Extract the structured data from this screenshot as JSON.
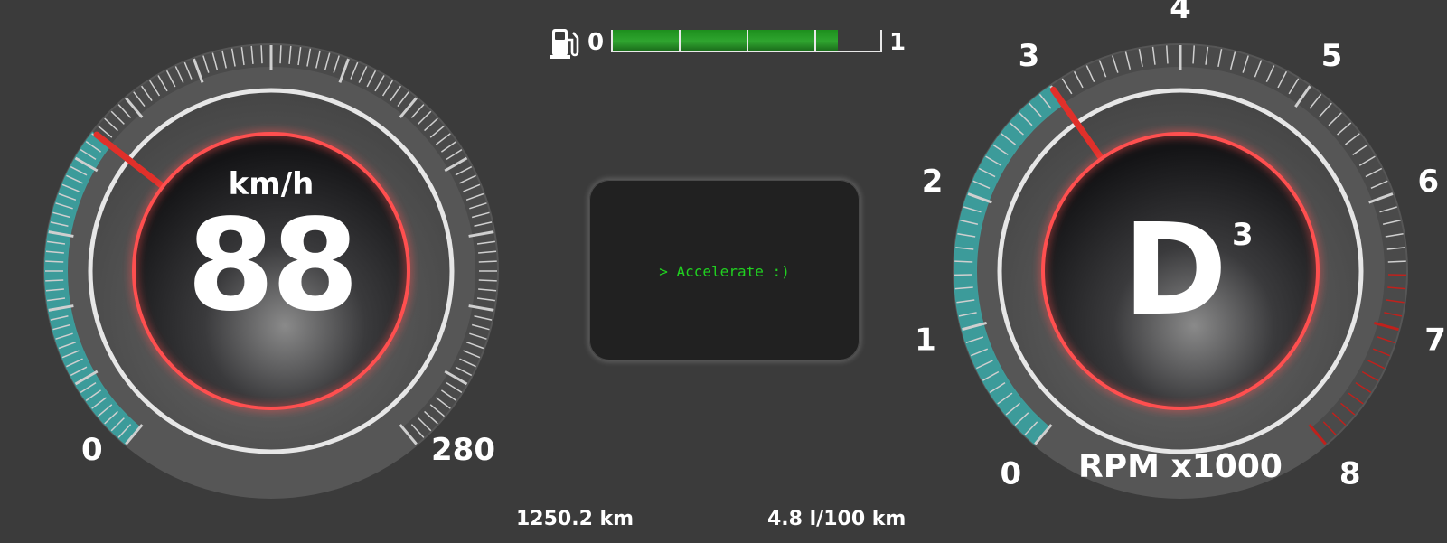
{
  "speedometer": {
    "unit": "km/h",
    "speed": "88",
    "min_label": "0",
    "max_label": "280",
    "needle_fraction": 0.3143
  },
  "fuel": {
    "icon": "fuel-pump-icon",
    "min_label": "0",
    "max_label": "1",
    "level": 0.84
  },
  "display": {
    "message": "> Accelerate :)"
  },
  "tachometer": {
    "gear": "D",
    "gear_number": "3",
    "unit": "RPM x1000",
    "labels": [
      "0",
      "1",
      "2",
      "3",
      "4",
      "5",
      "6",
      "7",
      "8"
    ],
    "needle_fraction": 0.375,
    "redline_start": 6.6
  },
  "trip": {
    "odometer": "1250.2 km",
    "consumption": "4.8 l/100 km"
  },
  "colors": {
    "background": "#3b3b3b",
    "accent_teal": "#3aa9a8",
    "needle_red": "#e0302a",
    "ring_red": "#ff5050",
    "fuel_green": "#2fa52f",
    "message_green": "#20d020"
  }
}
